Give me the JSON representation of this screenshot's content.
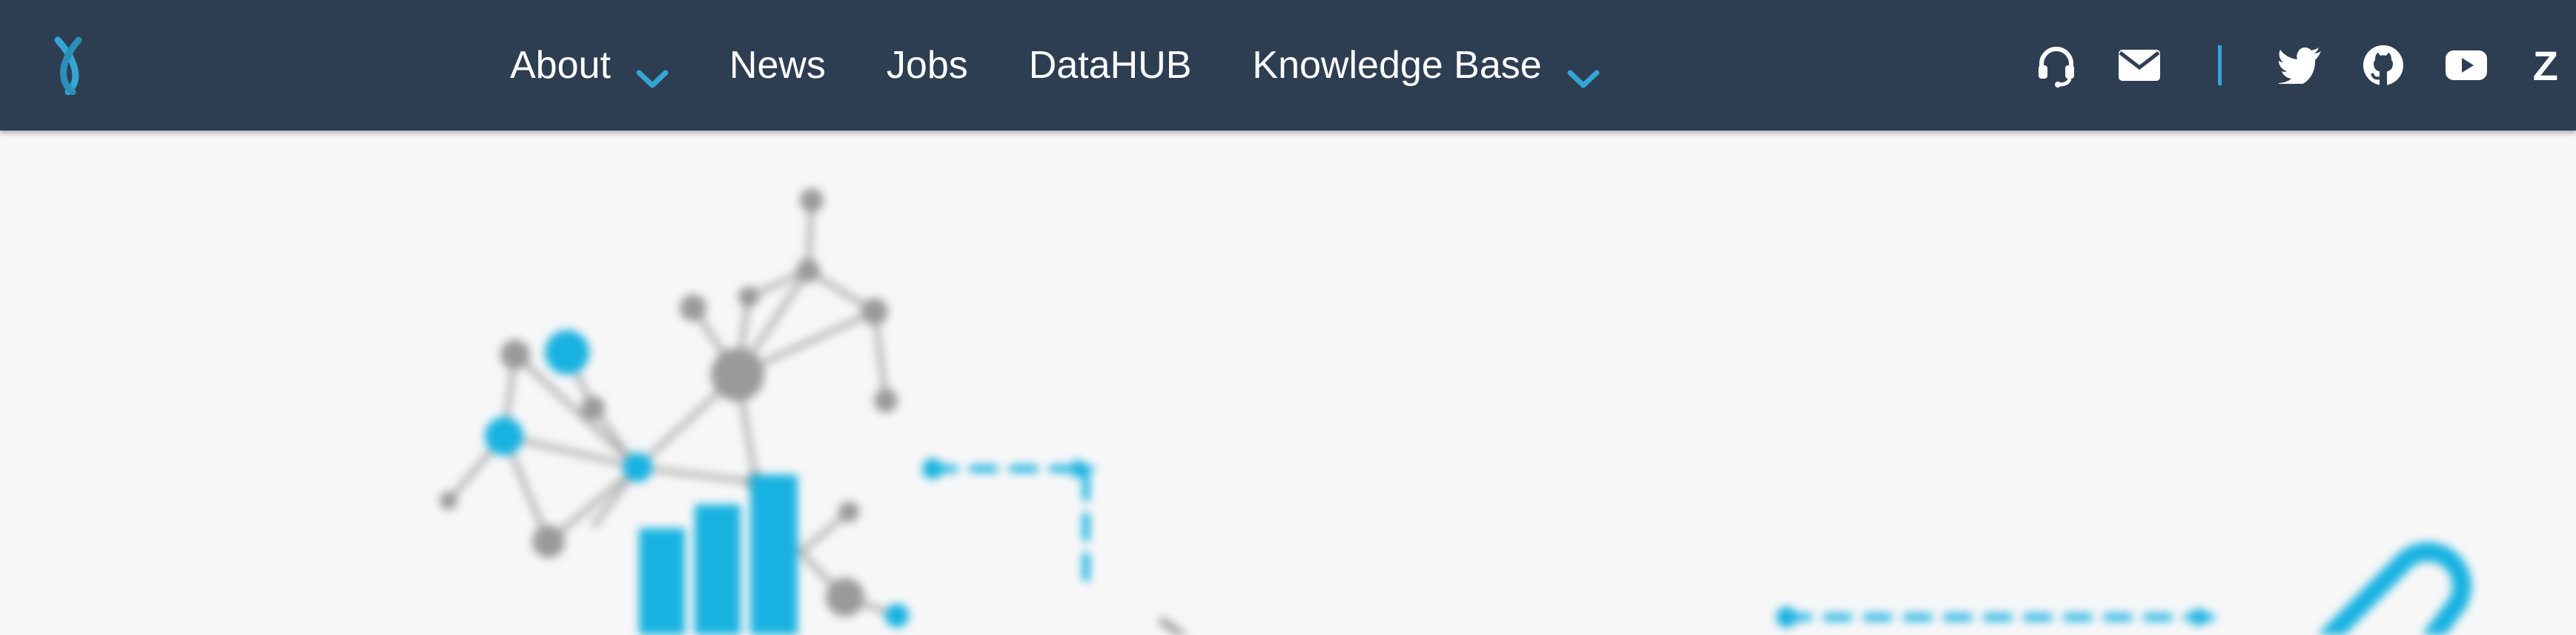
{
  "navbar": {
    "logo_icon": "dna-x-logo-icon",
    "items": [
      {
        "label": "About",
        "has_dropdown": true
      },
      {
        "label": "News",
        "has_dropdown": false
      },
      {
        "label": "Jobs",
        "has_dropdown": false
      },
      {
        "label": "DataHUB",
        "has_dropdown": false
      },
      {
        "label": "Knowledge Base",
        "has_dropdown": true
      }
    ],
    "right_icons": [
      "headset-support-icon",
      "envelope-icon",
      "twitter-icon",
      "github-icon",
      "youtube-icon"
    ],
    "language_label": "Z"
  },
  "hero": {
    "illustration": "blurred network graph with bar chart and dashed arrow connectors"
  },
  "colors": {
    "navbar_bg": "#2e3e52",
    "accent": "#33a6d6",
    "illustration_blue": "#18b2e0",
    "illustration_gray": "#9a9a9a",
    "page_bg": "#f7f7f8"
  }
}
